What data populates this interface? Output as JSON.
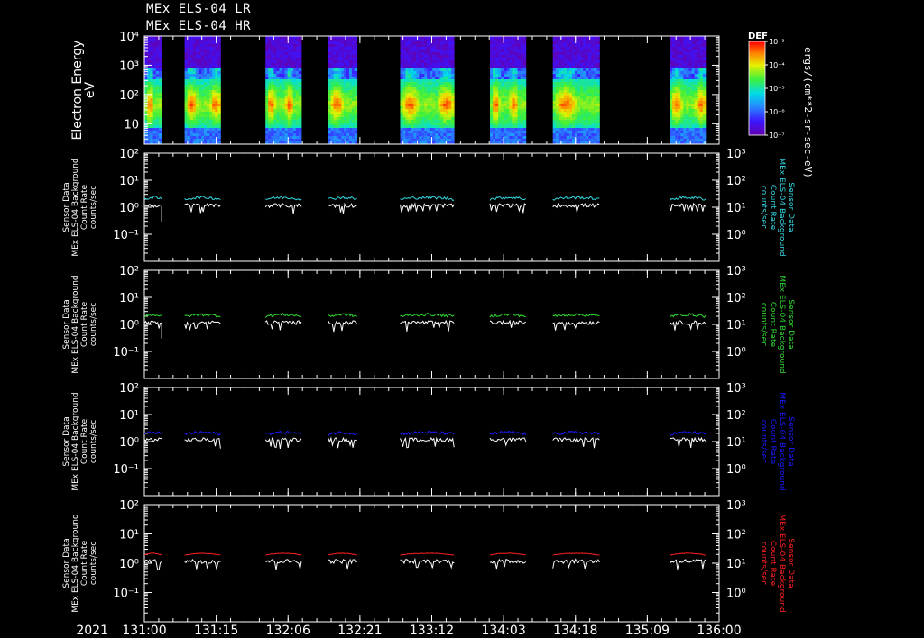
{
  "title_lines": [
    "MEx ELS-04 LR",
    "MEx ELS-04 HR"
  ],
  "colors": {
    "background": "#000000",
    "axes": "#ffffff",
    "panel1_series": "#33d6e0",
    "panel2_series": "#2fd92f",
    "panel3_series": "#1a1aff",
    "panel4_series": "#ff2020",
    "white_series": "#ffffff"
  },
  "chart_data": [
    {
      "type": "heatmap",
      "ylabel": [
        "Electron Energy",
        "eV"
      ],
      "scale": "log",
      "ylim": [
        2,
        10000
      ],
      "yticks": [
        "10",
        "10²",
        "10³",
        "10⁴"
      ],
      "colorbar": {
        "label": "DEF",
        "units": "ergs/(cm**2-sr-sec-eV)",
        "ticks": [
          "10⁻⁷",
          "10⁻⁶",
          "10⁻⁵",
          "10⁻⁴",
          "10⁻³"
        ]
      },
      "data_intervals": [
        [
          0.0,
          0.48
        ],
        [
          1.12,
          2.12
        ],
        [
          3.37,
          4.37
        ],
        [
          5.12,
          5.92
        ],
        [
          7.12,
          8.62
        ],
        [
          9.62,
          10.62
        ],
        [
          11.37,
          12.67
        ],
        [
          14.62,
          15.62
        ]
      ],
      "x_range": [
        0,
        16
      ]
    },
    {
      "type": "line",
      "ylabel_left": [
        "Sensor Data",
        "MEx ELS-04 Background",
        "Count Rate",
        "counts/sec"
      ],
      "ylabel_right": [
        "Sensor Data",
        "MEx ELS-04 Background",
        "Count Rate",
        "counts/sec"
      ],
      "ylim": [
        0.01,
        100
      ],
      "yticks_left": [
        "10⁻¹",
        "10⁰",
        "10¹",
        "10²"
      ],
      "yticks_right": [
        "10⁰",
        "10¹",
        "10²",
        "10³"
      ],
      "series": [
        {
          "color": "#33d6e0",
          "level": 2.0
        },
        {
          "color": "#ffffff",
          "level": 1.1
        }
      ]
    },
    {
      "type": "line",
      "ylabel_left": [
        "Sensor Data",
        "MEx ELS-04 Background",
        "Count Rate",
        "counts/sec"
      ],
      "ylabel_right": [
        "Sensor Data",
        "MEx ELS-04 Background",
        "Count Rate",
        "counts/sec"
      ],
      "ylim": [
        0.01,
        100
      ],
      "yticks_left": [
        "10⁻¹",
        "10⁰",
        "10¹",
        "10²"
      ],
      "yticks_right": [
        "10⁰",
        "10¹",
        "10²",
        "10³"
      ],
      "series": [
        {
          "color": "#2fd92f",
          "level": 2.0
        },
        {
          "color": "#ffffff",
          "level": 1.1
        }
      ]
    },
    {
      "type": "line",
      "ylabel_left": [
        "Sensor Data",
        "MEx ELS-04 Background",
        "Count Rate",
        "counts/sec"
      ],
      "ylabel_right": [
        "Sensor Data",
        "MEx ELS-04 Background",
        "Count Rate",
        "counts/sec"
      ],
      "ylim": [
        0.01,
        100
      ],
      "yticks_left": [
        "10⁻¹",
        "10⁰",
        "10¹",
        "10²"
      ],
      "yticks_right": [
        "10⁰",
        "10¹",
        "10²",
        "10³"
      ],
      "series": [
        {
          "color": "#1a1aff",
          "level": 1.9
        },
        {
          "color": "#ffffff",
          "level": 1.1
        }
      ]
    },
    {
      "type": "line",
      "ylabel_left": [
        "Sensor Data",
        "MEx ELS-04 Background",
        "Count Rate",
        "counts/sec"
      ],
      "ylabel_right": [
        "Sensor Data",
        "MEx ELS-04 Background",
        "Count Rate",
        "counts/sec"
      ],
      "ylim": [
        0.01,
        100
      ],
      "yticks_left": [
        "10⁻¹",
        "10⁰",
        "10¹",
        "10²"
      ],
      "yticks_right": [
        "10⁰",
        "10¹",
        "10²",
        "10³"
      ],
      "series": [
        {
          "color": "#ff2020",
          "level": 1.9
        },
        {
          "color": "#ffffff",
          "level": 1.1
        }
      ]
    }
  ],
  "x_axis": {
    "year": "2021",
    "tick_labels": [
      "131:00",
      "131:15",
      "132:06",
      "132:21",
      "133:12",
      "134:03",
      "134:18",
      "135:09",
      "136:00"
    ],
    "range": [
      0,
      16
    ]
  }
}
